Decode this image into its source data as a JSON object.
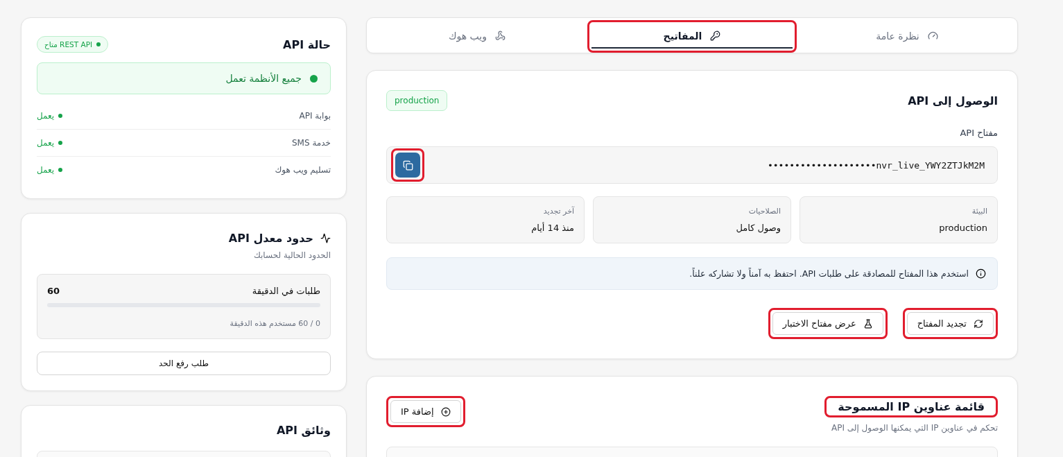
{
  "tabs": [
    {
      "label": "نظرة عامة",
      "selected": false,
      "highlighted": false
    },
    {
      "label": "المفاتيح",
      "selected": true,
      "highlighted": true
    },
    {
      "label": "ويب هوك",
      "selected": false,
      "highlighted": false
    }
  ],
  "api_access": {
    "title": "الوصول إلى API",
    "badge": "production",
    "key_label": "مفتاح API",
    "key_value": "••••••••••••••••••••nvr_live_YWY2ZTJkM2M",
    "copy_highlighted": true,
    "facts": [
      {
        "label": "البيئة",
        "value": "production"
      },
      {
        "label": "الصلاحيات",
        "value": "وصول كامل"
      },
      {
        "label": "آخر تجديد",
        "value": "منذ 14 أيام"
      }
    ],
    "notice": "استخدم هذا المفتاح للمصادقة على طلبات API. احتفظ به آمناً ولا تشاركه علناً.",
    "buttons": [
      {
        "label": "تجديد المفتاح",
        "highlighted": true
      },
      {
        "label": "عرض مفتاح الاختبار",
        "highlighted": true
      }
    ]
  },
  "ip_whitelist": {
    "title": "قائمة عناوين IP المسموحة",
    "title_highlighted": true,
    "subtitle": "تحكم في عناوين IP التي يمكنها الوصول إلى API",
    "add_button": {
      "label": "إضافة IP",
      "highlighted": true
    }
  },
  "api_status": {
    "title": "حالة API",
    "badge": "REST API متاح",
    "overall": "جميع الأنظمة تعمل",
    "services": [
      {
        "name": "بوابة API",
        "status": "يعمل",
        "color": "#16a34a"
      },
      {
        "name": "خدمة SMS",
        "status": "يعمل",
        "color": "#16a34a"
      },
      {
        "name": "تسليم ويب هوك",
        "status": "يعمل",
        "color": "#16a34a"
      }
    ]
  },
  "rate_limits": {
    "title": "حدود معدل API",
    "subtitle": "الحدود الحالية لحسابك",
    "metric_label": "طلبات في الدقيقة",
    "metric_value": "60",
    "level": 0,
    "usage": "0 / 60 مستخدم هذه الدقيقة",
    "button": "طلب رفع الحد"
  },
  "docs": {
    "title": "وثائق API"
  }
}
